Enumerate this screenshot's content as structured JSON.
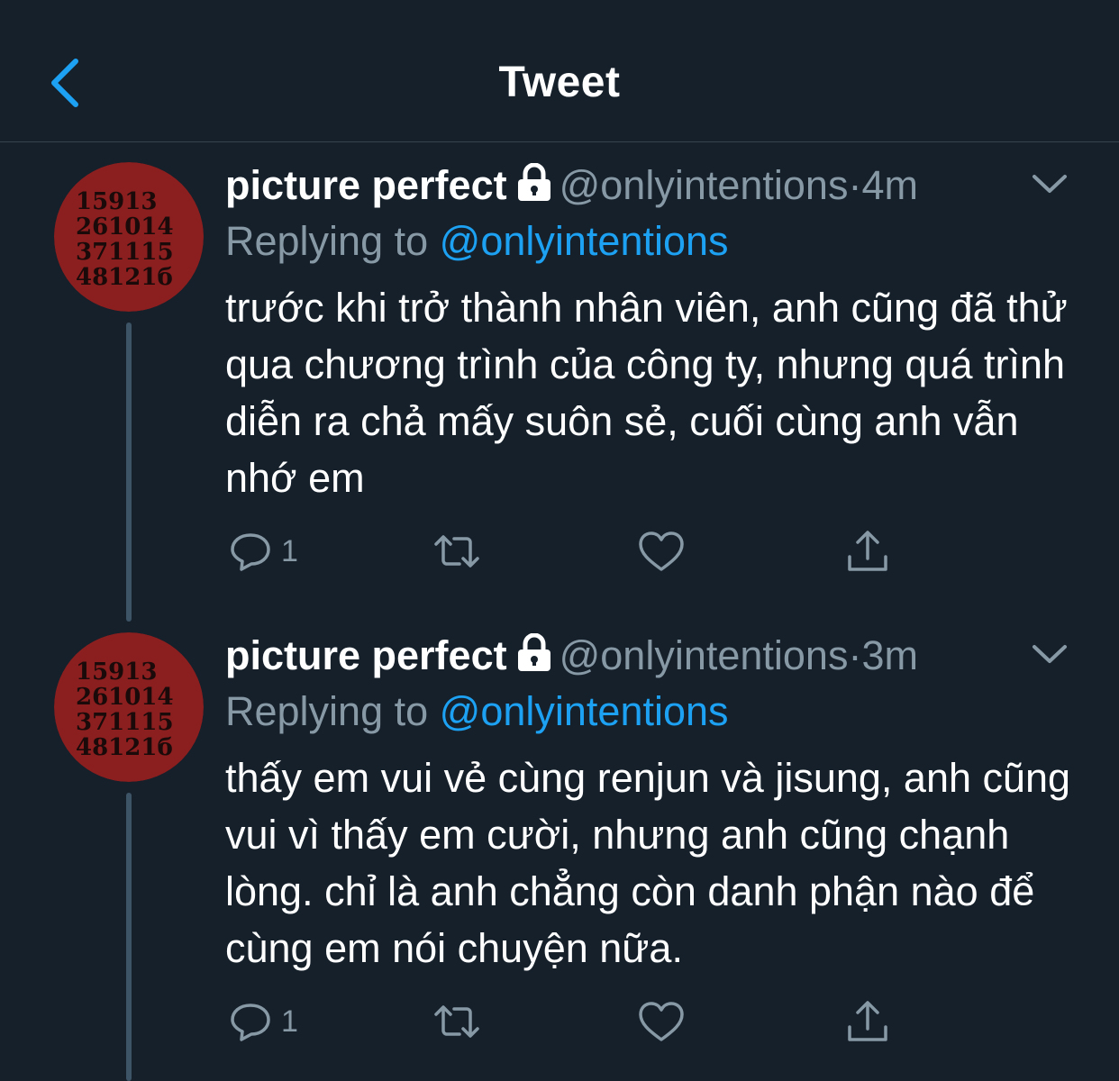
{
  "header": {
    "title": "Tweet"
  },
  "icons": {
    "back": "chevron-left-icon",
    "lock": "lock-icon",
    "caret": "chevron-down-icon",
    "reply": "reply-icon",
    "retweet": "retweet-icon",
    "like": "heart-icon",
    "share": "share-icon"
  },
  "avatar_text": [
    "15913",
    "261014",
    "371115",
    "48121б"
  ],
  "tweets": [
    {
      "name": "picture perfect",
      "handle": "@onlyintentions",
      "separator": "·",
      "time": "4m",
      "reply_prefix": "Replying to",
      "reply_handle": "@onlyintentions",
      "text": "trước khi trở thành nhân viên, anh cũng đã thử qua chương trình của công ty, nhưng quá trình diễn ra chả mấy suôn sẻ, cuối cùng anh vẫn nhớ em",
      "reply_count": "1"
    },
    {
      "name": "picture perfect",
      "handle": "@onlyintentions",
      "separator": "·",
      "time": "3m",
      "reply_prefix": "Replying to",
      "reply_handle": "@onlyintentions",
      "text": "thấy em vui vẻ cùng renjun và jisung, anh cũng vui vì thấy em cười, nhưng anh cũng chạnh lòng. chỉ là anh chẳng còn danh phận nào để cùng em nói chuyện nữa.",
      "reply_count": "1"
    }
  ],
  "colors": {
    "background": "#15202b",
    "accent": "#1da1f2",
    "muted": "#8899a6",
    "avatar": "#8b1e1e"
  }
}
